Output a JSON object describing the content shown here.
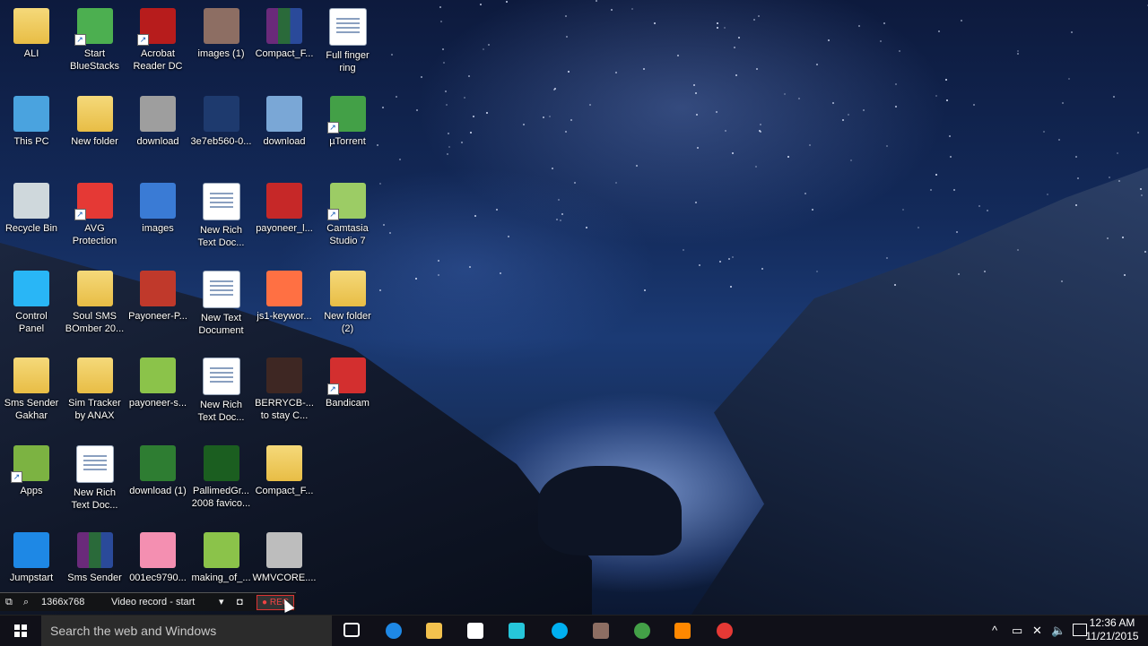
{
  "desktop": {
    "icons": [
      {
        "label": "ALI",
        "icon": "user-folder-icon",
        "color": "#e8bd45",
        "shortcut": false
      },
      {
        "label": "Start\nBlueStacks",
        "icon": "bluestacks-icon",
        "color": "#4caf50",
        "shortcut": true
      },
      {
        "label": "Acrobat\nReader DC",
        "icon": "acrobat-icon",
        "color": "#b71c1c",
        "shortcut": true
      },
      {
        "label": "images (1)",
        "icon": "image-file-icon",
        "color": "#8d6e63",
        "shortcut": false
      },
      {
        "label": "Compact_F...",
        "icon": "winrar-archive-icon",
        "color": "#6a2a7a",
        "shortcut": false
      },
      {
        "label": "Full finger\nring",
        "icon": "document-icon",
        "color": "#ffffff",
        "shortcut": false
      },
      {
        "label": "This PC",
        "icon": "computer-icon",
        "color": "#4aa3df",
        "shortcut": false
      },
      {
        "label": "New folder",
        "icon": "folder-icon",
        "color": "#e8bd45",
        "shortcut": false
      },
      {
        "label": "download",
        "icon": "image-file-icon",
        "color": "#9e9e9e",
        "shortcut": false
      },
      {
        "label": "3e7eb560-0...",
        "icon": "image-file-icon",
        "color": "#1e3a6e",
        "shortcut": false
      },
      {
        "label": "download",
        "icon": "image-file-icon",
        "color": "#7aa7d6",
        "shortcut": false
      },
      {
        "label": "µTorrent",
        "icon": "utorrent-icon",
        "color": "#43a047",
        "shortcut": true
      },
      {
        "label": "Recycle Bin",
        "icon": "recycle-bin-icon",
        "color": "#cfd8dc",
        "shortcut": false
      },
      {
        "label": "AVG\nProtection",
        "icon": "avg-icon",
        "color": "#e53935",
        "shortcut": true
      },
      {
        "label": "images",
        "icon": "image-file-icon",
        "color": "#3a7bd5",
        "shortcut": false
      },
      {
        "label": "New Rich\nText Doc...",
        "icon": "document-icon",
        "color": "#ffffff",
        "shortcut": false
      },
      {
        "label": "payoneer_l...",
        "icon": "image-file-icon",
        "color": "#c62828",
        "shortcut": false
      },
      {
        "label": "Camtasia\nStudio 7",
        "icon": "camtasia-icon",
        "color": "#9ccc65",
        "shortcut": true
      },
      {
        "label": "Control\nPanel",
        "icon": "control-panel-icon",
        "color": "#29b6f6",
        "shortcut": false
      },
      {
        "label": "Soul SMS\nBOmber 20...",
        "icon": "folder-icon",
        "color": "#e8bd45",
        "shortcut": false
      },
      {
        "label": "Payoneer-P...",
        "icon": "image-file-icon",
        "color": "#c0392b",
        "shortcut": false
      },
      {
        "label": "New Text\nDocument",
        "icon": "text-file-icon",
        "color": "#ffffff",
        "shortcut": false
      },
      {
        "label": "js1-keywor...",
        "icon": "image-file-icon",
        "color": "#ff7043",
        "shortcut": false
      },
      {
        "label": "New folder\n(2)",
        "icon": "chrome-folder-icon",
        "color": "#e8bd45",
        "shortcut": false
      },
      {
        "label": "Sms Sender\nGakhar",
        "icon": "folder-icon",
        "color": "#e8bd45",
        "shortcut": false
      },
      {
        "label": "Sim Tracker\nby ANAX",
        "icon": "folder-icon",
        "color": "#e8bd45",
        "shortcut": false
      },
      {
        "label": "payoneer-s...",
        "icon": "image-file-icon",
        "color": "#8bc34a",
        "shortcut": false
      },
      {
        "label": "New Rich\nText Doc...",
        "icon": "document-icon",
        "color": "#ffffff",
        "shortcut": false
      },
      {
        "label": "BERRYCB-...\nto stay C...",
        "icon": "image-file-icon",
        "color": "#3e2723",
        "shortcut": false
      },
      {
        "label": "Bandicam",
        "icon": "bandicam-icon",
        "color": "#d32f2f",
        "shortcut": true
      },
      {
        "label": "Apps",
        "icon": "android-apps-icon",
        "color": "#7cb342",
        "shortcut": true
      },
      {
        "label": "New Rich\nText Doc...",
        "icon": "document-icon",
        "color": "#ffffff",
        "shortcut": false
      },
      {
        "label": "download (1)",
        "icon": "payza-image-icon",
        "color": "#2e7d32",
        "shortcut": false
      },
      {
        "label": "PallimedGr...\n2008 favico...",
        "icon": "favicon-p-icon",
        "color": "#1b5e20",
        "shortcut": false
      },
      {
        "label": "Compact_F...",
        "icon": "folder-icon",
        "color": "#e8bd45",
        "shortcut": false
      },
      {
        "label": "",
        "icon": "",
        "color": "",
        "shortcut": false
      },
      {
        "label": "Jumpstart",
        "icon": "jumpstart-icon",
        "color": "#1e88e5",
        "shortcut": false
      },
      {
        "label": "Sms Sender",
        "icon": "winrar-archive-icon",
        "color": "#6a2a7a",
        "shortcut": false
      },
      {
        "label": "001ec9790...",
        "icon": "image-file-icon",
        "color": "#f48fb1",
        "shortcut": false
      },
      {
        "label": "making_of_...",
        "icon": "image-file-icon",
        "color": "#8bc34a",
        "shortcut": false
      },
      {
        "label": "WMVCORE....",
        "icon": "system-file-icon",
        "color": "#bdbdbd",
        "shortcut": false
      }
    ]
  },
  "recorder": {
    "resolution": "1366x768",
    "mode": "Video record - start",
    "rec_label": "REC"
  },
  "taskbar": {
    "search_placeholder": "Search the web and Windows",
    "items": [
      {
        "name": "task-view",
        "icon": "task-view-icon",
        "color": "#ffffff"
      },
      {
        "name": "edge",
        "icon": "edge-icon",
        "color": "#1e88e5"
      },
      {
        "name": "file-explorer",
        "icon": "folder-icon",
        "color": "#f2c14e"
      },
      {
        "name": "store",
        "icon": "store-icon",
        "color": "#ffffff"
      },
      {
        "name": "app-5",
        "icon": "loading-icon",
        "color": "#26c6da"
      },
      {
        "name": "skype",
        "icon": "skype-icon",
        "color": "#00aff0"
      },
      {
        "name": "app-7",
        "icon": "game-icon",
        "color": "#8d6e63"
      },
      {
        "name": "utorrent",
        "icon": "utorrent-icon",
        "color": "#43a047"
      },
      {
        "name": "vlc",
        "icon": "vlc-icon",
        "color": "#ff8800"
      },
      {
        "name": "chrome",
        "icon": "chrome-icon",
        "color": "#e53935"
      }
    ],
    "tray": {
      "time": "12:36 AM",
      "date": "11/21/2015"
    }
  }
}
